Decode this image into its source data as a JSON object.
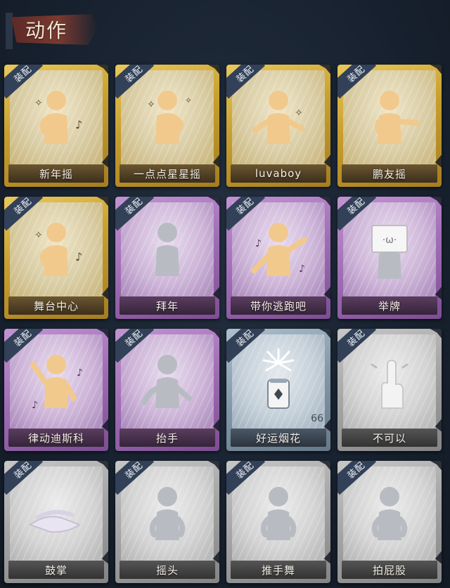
{
  "header": {
    "title": "动作"
  },
  "badge_label": "装配",
  "cards": [
    {
      "name": "新年摇",
      "rarity": "gold",
      "icon": "figure-wave-icon",
      "equipped": true
    },
    {
      "name": "一点点星星摇",
      "rarity": "gold",
      "icon": "figure-star-shake-icon",
      "equipped": true
    },
    {
      "name": "luvaboy",
      "rarity": "gold",
      "icon": "figure-pose-icon",
      "equipped": true
    },
    {
      "name": "鹏友摇",
      "rarity": "gold",
      "icon": "figure-point-icon",
      "equipped": true
    },
    {
      "name": "舞台中心",
      "rarity": "gold",
      "icon": "figure-center-stage-icon",
      "equipped": true
    },
    {
      "name": "拜年",
      "rarity": "purple",
      "icon": "figure-bow-icon",
      "equipped": true
    },
    {
      "name": "带你逃跑吧",
      "rarity": "purple",
      "icon": "figure-run-icon",
      "equipped": true
    },
    {
      "name": "举牌",
      "rarity": "purple",
      "icon": "figure-sign-icon",
      "equipped": true
    },
    {
      "name": "律动迪斯科",
      "rarity": "purple",
      "icon": "figure-disco-icon",
      "equipped": true
    },
    {
      "name": "抬手",
      "rarity": "purple",
      "icon": "hand-raise-icon",
      "equipped": true
    },
    {
      "name": "好运烟花",
      "rarity": "bluegray",
      "icon": "firework-icon",
      "equipped": true,
      "count": "66"
    },
    {
      "name": "不可以",
      "rarity": "gray",
      "icon": "finger-wag-icon",
      "equipped": true
    },
    {
      "name": "鼓掌",
      "rarity": "gray",
      "icon": "clap-icon",
      "equipped": true
    },
    {
      "name": "摇头",
      "rarity": "gray",
      "icon": "head-shake-icon",
      "equipped": true
    },
    {
      "name": "推手舞",
      "rarity": "gray",
      "icon": "push-dance-icon",
      "equipped": true
    },
    {
      "name": "拍屁股",
      "rarity": "gray",
      "icon": "butt-slap-icon",
      "equipped": true
    }
  ],
  "colors": {
    "gold": "#c79e2e",
    "purple": "#9f6db5",
    "bluegray": "#8297a8",
    "gray": "#a3a3a3",
    "badge": "#324158",
    "figure_gold": "#f2c98c",
    "figure_gray": "#b8bcc2"
  }
}
